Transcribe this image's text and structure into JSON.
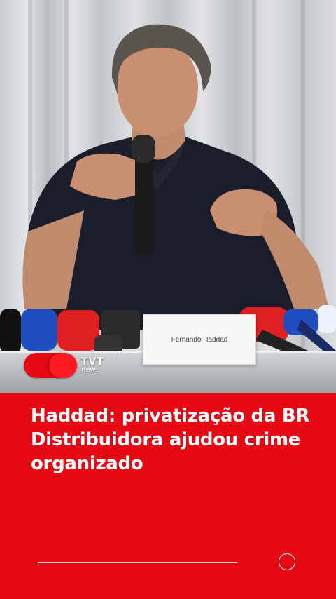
{
  "video": {
    "nameplate_text": "Fernando Haddad"
  },
  "brand": {
    "logo_main": "TVT",
    "logo_sub": "news",
    "color": "#e50914"
  },
  "headline": {
    "text": "Haddad: privatização da BR Distribuidora ajudou crime organizado"
  },
  "controls": {
    "progress_icon": "progress-line",
    "action_icon": "circle-icon"
  }
}
